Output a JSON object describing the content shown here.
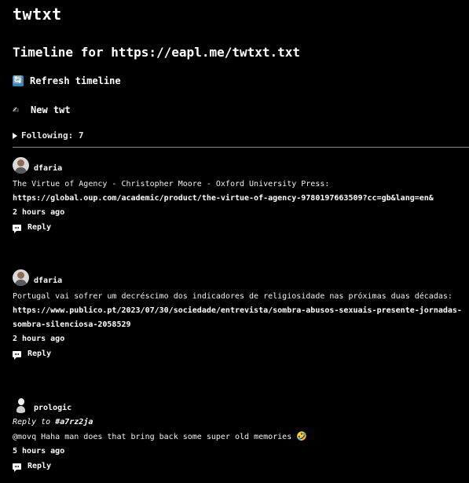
{
  "site": {
    "title": "twtxt"
  },
  "timeline": {
    "heading": "Timeline for https://eapl.me/twtxt.txt"
  },
  "actions": {
    "refresh_icon": "refresh-icon",
    "refresh_glyph": "🔄",
    "refresh_label": "Refresh timeline",
    "new_icon": "writing-hand-icon",
    "new_glyph": "✍",
    "new_label": "New twt"
  },
  "following": {
    "label": "Following: 7"
  },
  "twts": [
    {
      "nick": "dfaria",
      "avatar": "dfaria-avatar",
      "text": "The Virtue of Agency - Christopher Moore - Oxford University Press:",
      "url_lines": [
        "https://global.oup.com/academic/product/the-virtue-of-agency-9780197663509?cc=gb&lang=en&"
      ],
      "time": "2 hours ago",
      "reply_label": "Reply"
    },
    {
      "nick": "dfaria",
      "avatar": "dfaria-avatar",
      "text": "Portugal vai sofrer um decréscimo dos indicadores de religiosidade nas próximas duas décadas:",
      "url_lines": [
        "https://www.publico.pt/2023/07/30/sociedade/entrevista/sombra-abusos-sexuais-presente-jornadas-",
        "sombra-silenciosa-2058529"
      ],
      "time": "2 hours ago",
      "reply_label": "Reply"
    },
    {
      "nick": "prologic",
      "avatar": "prologic-avatar",
      "reply_to_prefix": "Reply to",
      "reply_to_hash": "#a7rz2ja",
      "text": "@movq Haha man does that bring back some super old memories",
      "emoji": "🤣",
      "time": "5 hours ago",
      "reply_label": "Reply"
    }
  ]
}
